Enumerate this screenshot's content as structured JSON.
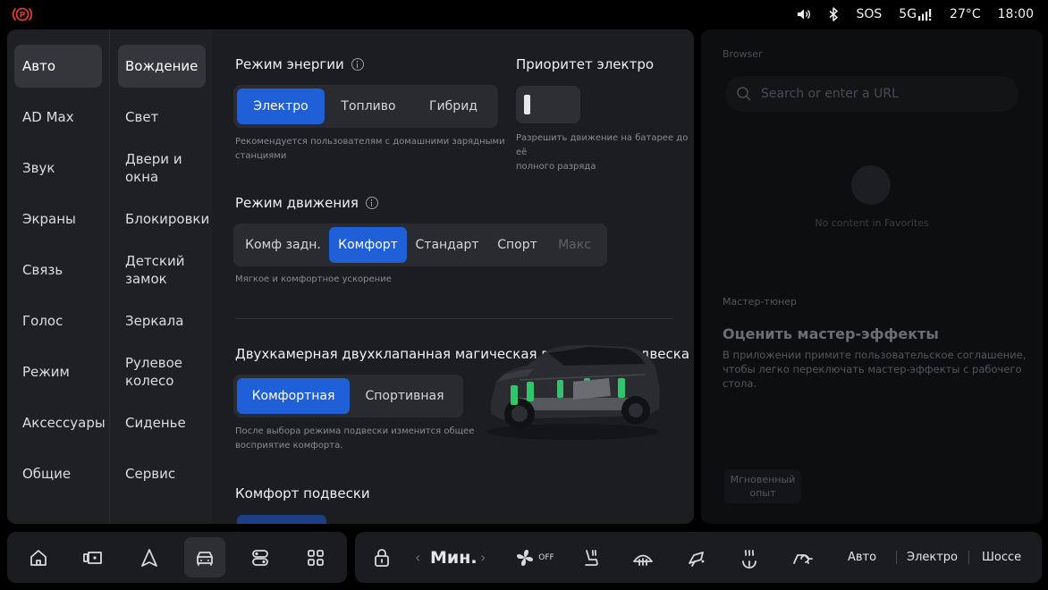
{
  "status": {
    "sos": "SOS",
    "network": "5G",
    "temperature": "27°C",
    "time": "18:00",
    "icons": [
      "parking-brake-alert-icon",
      "volume-icon",
      "bluetooth-icon",
      "signal-icon"
    ]
  },
  "nav_primary": [
    "Авто",
    "AD Max",
    "Звук",
    "Экраны",
    "Связь",
    "Голос",
    "Режим",
    "Аксессуары",
    "Общие"
  ],
  "nav_secondary": [
    "Вождение",
    "Свет",
    "Двери и окна",
    "Блокировки",
    "Детский замок",
    "Зеркала",
    "Рулевое колесо",
    "Сиденье",
    "Сервис"
  ],
  "energy": {
    "title": "Режим энергии",
    "options": [
      "Электро",
      "Топливо",
      "Гибрид"
    ],
    "selected": "Электро",
    "hint_line1": "Рекомендуется пользователям с домашними зарядными",
    "hint_line2": "станциями"
  },
  "priority": {
    "title": "Приоритет электро",
    "enabled": false,
    "hint_line1": "Разрешить движение на батарее до её",
    "hint_line2": "полного разряда"
  },
  "drive": {
    "title": "Режим движения",
    "options": [
      "Комф задн.",
      "Комфорт",
      "Стандарт",
      "Спорт",
      "Макс"
    ],
    "selected": "Комфорт",
    "disabled": "Макс",
    "hint": "Мягкое и комфортное ускорение"
  },
  "suspension": {
    "title": "Двухкамерная двухклапанная магическая воздушная подвеска",
    "options": [
      "Комфортная",
      "Спортивная"
    ],
    "selected": "Комфортная",
    "hint_line1": "После выбора режима подвески изменится общее",
    "hint_line2": "восприятие комфорта."
  },
  "comfort": {
    "title": "Комфорт подвески"
  },
  "browser": {
    "label": "Browser",
    "search_placeholder": "Search or enter a URL",
    "empty_text": "No content in Favorites",
    "tuner_label": "Мастер-тюнер",
    "tuner_title": "Оценить мастер-эффекты",
    "tuner_desc": "В приложении примите пользовательское соглашение, чтобы легко переключать мастер-эффекты с рабочего стола.",
    "instant_line1": "Мгновенный",
    "instant_line2": "опыт"
  },
  "dock": {
    "apps": [
      "home-icon",
      "media-icon",
      "navigation-icon",
      "car-icon",
      "toggle-panel-icon",
      "apps-grid-icon"
    ],
    "active_app": "car-icon",
    "fan_value": "Мин.",
    "fan_state": "OFF",
    "modes": [
      "Авто",
      "Электро",
      "Шоссе"
    ]
  }
}
